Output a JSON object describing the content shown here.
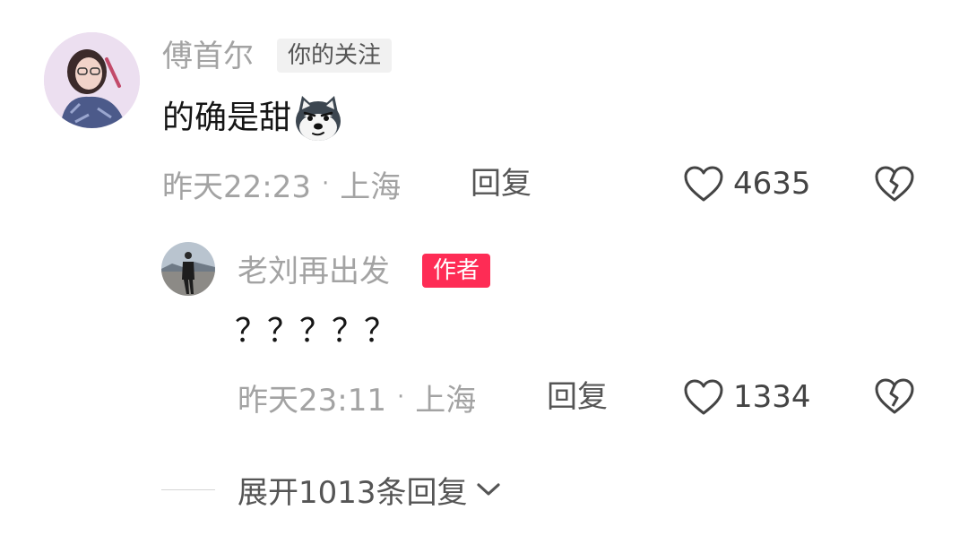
{
  "comment": {
    "username": "傅首尔",
    "follow_badge": "你的关注",
    "text": "的确是甜",
    "emoji_icon": "husky-dog-emoji-icon",
    "time": "昨天22:23",
    "separator": "·",
    "location": "上海",
    "reply_label": "回复",
    "like_count": "4635",
    "like_icon": "heart-outline-icon",
    "dislike_icon": "broken-heart-icon"
  },
  "reply": {
    "username": "老刘再出发",
    "author_badge": "作者",
    "text": "？？？？？",
    "time": "昨天23:11",
    "separator": "·",
    "location": "上海",
    "reply_label": "回复",
    "like_count": "1334",
    "like_icon": "heart-outline-icon",
    "dislike_icon": "broken-heart-icon"
  },
  "expand": {
    "label": "展开1013条回复",
    "icon": "chevron-down-icon"
  },
  "colors": {
    "author_badge": "#fe2c55",
    "meta_gray": "#a3a3a3",
    "text_dark": "#161616"
  }
}
